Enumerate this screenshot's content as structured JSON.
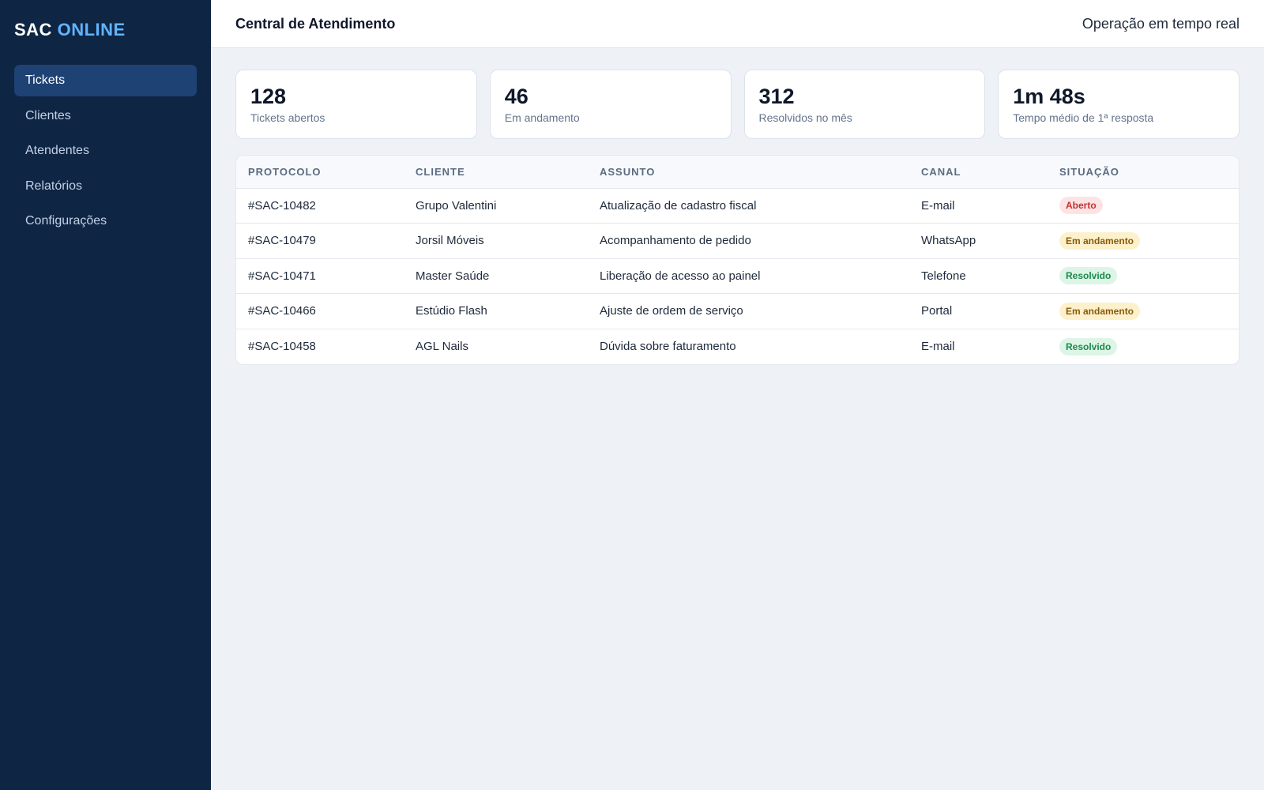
{
  "brand": {
    "part1": "SAC",
    "part2": "ONLINE"
  },
  "sidebar": {
    "items": [
      {
        "label": "Tickets",
        "active": true
      },
      {
        "label": "Clientes",
        "active": false
      },
      {
        "label": "Atendentes",
        "active": false
      },
      {
        "label": "Relatórios",
        "active": false
      },
      {
        "label": "Configurações",
        "active": false
      }
    ]
  },
  "header": {
    "title": "Central de Atendimento",
    "status": "Operação em tempo real"
  },
  "stats": [
    {
      "value": "128",
      "label": "Tickets abertos"
    },
    {
      "value": "46",
      "label": "Em andamento"
    },
    {
      "value": "312",
      "label": "Resolvidos no mês"
    },
    {
      "value": "1m 48s",
      "label": "Tempo médio de 1ª resposta"
    }
  ],
  "table": {
    "headers": [
      "PROTOCOLO",
      "CLIENTE",
      "ASSUNTO",
      "CANAL",
      "SITUAÇÃO"
    ],
    "rows": [
      {
        "protocolo": "#SAC-10482",
        "cliente": "Grupo Valentini",
        "assunto": "Atualização de cadastro fiscal",
        "canal": "E-mail",
        "situacao": "Aberto",
        "status": "aberto"
      },
      {
        "protocolo": "#SAC-10479",
        "cliente": "Jorsil Móveis",
        "assunto": "Acompanhamento de pedido",
        "canal": "WhatsApp",
        "situacao": "Em andamento",
        "status": "andamento"
      },
      {
        "protocolo": "#SAC-10471",
        "cliente": "Master Saúde",
        "assunto": "Liberação de acesso ao painel",
        "canal": "Telefone",
        "situacao": "Resolvido",
        "status": "resolvido"
      },
      {
        "protocolo": "#SAC-10466",
        "cliente": "Estúdio Flash",
        "assunto": "Ajuste de ordem de serviço",
        "canal": "Portal",
        "situacao": "Em andamento",
        "status": "andamento"
      },
      {
        "protocolo": "#SAC-10458",
        "cliente": "AGL Nails",
        "assunto": "Dúvida sobre faturamento",
        "canal": "E-mail",
        "situacao": "Resolvido",
        "status": "resolvido"
      }
    ]
  },
  "colors": {
    "sidebar_bg": "#0f2544",
    "accent": "#60b4ff",
    "active_nav": "#1e4273",
    "aberto": "#c53030",
    "andamento": "#8a5a0b",
    "resolvido": "#1c8a4c"
  }
}
